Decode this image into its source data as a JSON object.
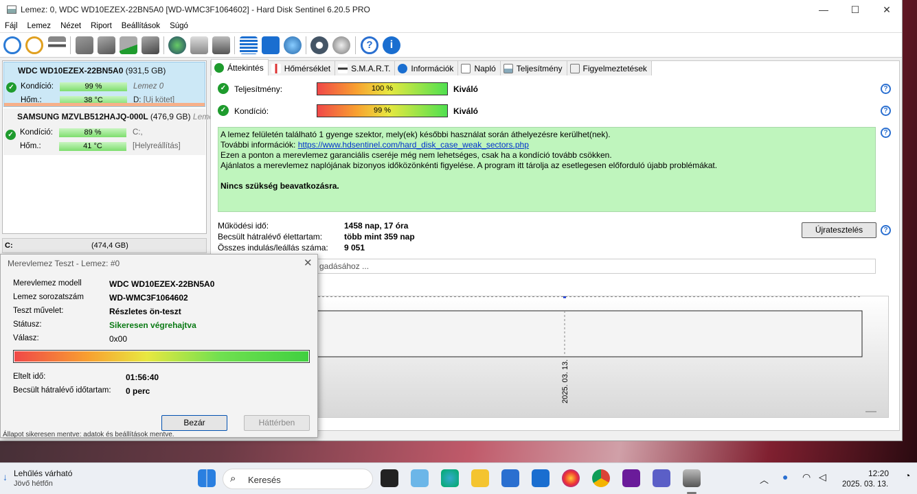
{
  "window": {
    "title": "Lemez: 0, WDC WD10EZEX-22BN5A0 [WD-WMC3F1064602]  -  Hard Disk Sentinel 6.20.5 PRO",
    "minimize": "—",
    "maximize": "☐",
    "close": "✕"
  },
  "menu": [
    "Fájl",
    "Lemez",
    "Nézet",
    "Riport",
    "Beállítások",
    "Súgó"
  ],
  "disks": [
    {
      "name": "WDC WD10EZEX-22BN5A0",
      "size": "(931,5 GB)",
      "condition_label": "Kondíció:",
      "condition": "99 %",
      "extra1": "Lemez 0",
      "temp_label": "Hőm.:",
      "temp": "38 °C",
      "drive": "D:",
      "volume": "[Új kötet]"
    },
    {
      "name": "SAMSUNG MZVLB512HAJQ-000L",
      "size": "(476,9 GB)",
      "extra0": "Leme",
      "condition_label": "Kondíció:",
      "condition": "89 %",
      "extra1": "C:,",
      "temp_label": "Hőm.:",
      "temp": "41 °C",
      "volume": "[Helyreállítás]"
    }
  ],
  "volume_bar": {
    "drive": "C:",
    "size": "(474,4 GB)"
  },
  "tabs": [
    "Áttekintés",
    "Hőmérséklet",
    "S.M.A.R.T.",
    "Információk",
    "Napló",
    "Teljesítmény",
    "Figyelmeztetések"
  ],
  "overview": {
    "performance_label": "Teljesítmény:",
    "performance": "100 %",
    "performance_text": "Kiváló",
    "health_label": "Kondíció:",
    "health": "99 %",
    "health_text": "Kiváló",
    "message_lines": [
      "A lemez felületén található 1 gyenge szektor, mely(ek) későbbi használat során áthelyezésre kerülhet(nek).",
      "További információk: ",
      "Ezen a ponton a merevlemez garanciális cseréje még nem lehetséges, csak ha a kondíció tovább csökken.",
      "Ajánlatos a merevlemez naplójának bizonyos időközönkénti figyelése. A program itt tárolja az esetlegesen előforduló újabb problémákat."
    ],
    "message_link": "https://www.hdsentinel.com/hard_disk_case_weak_sectors.php",
    "message_bold": "Nincs szükség beavatkozásra.",
    "uptime_label": "Működési idő:",
    "uptime": "1458 nap, 17 óra",
    "remaining_label": "Becsült hátralévő élettartam:",
    "remaining": "több mint 359 nap",
    "starts_label": "Összes indulás/leállás száma:",
    "starts": "9 051",
    "retest_button": "Újratesztelés",
    "search_placeholder": "gadásához ..."
  },
  "chart_data": {
    "type": "line",
    "x": [
      "2025. 03. 13."
    ],
    "series": [
      {
        "values": [
          99
        ]
      }
    ],
    "ylim": [
      0,
      100
    ],
    "data_label": "99"
  },
  "dialog": {
    "title": "Merevlemez Teszt - Lemez: #0",
    "close": "✕",
    "model_label": "Merevlemez modell",
    "model": "WDC WD10EZEX-22BN5A0",
    "serial_label": "Lemez sorozatszám",
    "serial": "WD-WMC3F1064602",
    "operation_label": "Teszt művelet:",
    "operation": "Részletes ön-teszt",
    "status_label": "Státusz:",
    "status": "Sikeresen végrehajtva",
    "response_label": "Válasz:",
    "response": "0x00",
    "progress": 1.0,
    "elapsed_label": "Eltelt idő:",
    "elapsed": "01:56:40",
    "remaining_label": "Becsült hátralévő időtartam:",
    "remaining": "0 perc",
    "close_button": "Bezár",
    "background_button": "Háttérben"
  },
  "statusbar": "Állapot sikeresen mentve: adatok és beállítások mentve.",
  "taskbar": {
    "weather_title": "Lehűlés várható",
    "weather_sub": "Jövő hétfőn",
    "search": "Keresés",
    "time": "12:20",
    "date": "2025. 03. 13."
  },
  "colors": {
    "ok_green": "#1e9b2d",
    "message_bg": "#bff5bd",
    "selected_disk": "#cce8f6",
    "help_blue": "#2a6fd0"
  }
}
